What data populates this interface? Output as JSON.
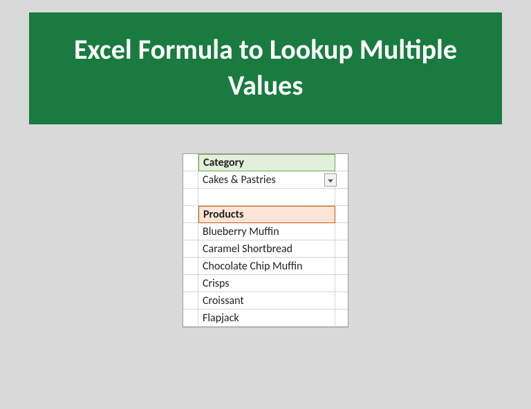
{
  "banner": {
    "title": "Excel Formula to Lookup Multiple Values"
  },
  "sheet": {
    "category_header": "Category",
    "category_value": "Cakes & Pastries",
    "products_header": "Products",
    "products": [
      "Blueberry Muffin",
      "Caramel Shortbread",
      "Chocolate Chip Muffin",
      "Crisps",
      "Croissant",
      "Flapjack"
    ]
  }
}
